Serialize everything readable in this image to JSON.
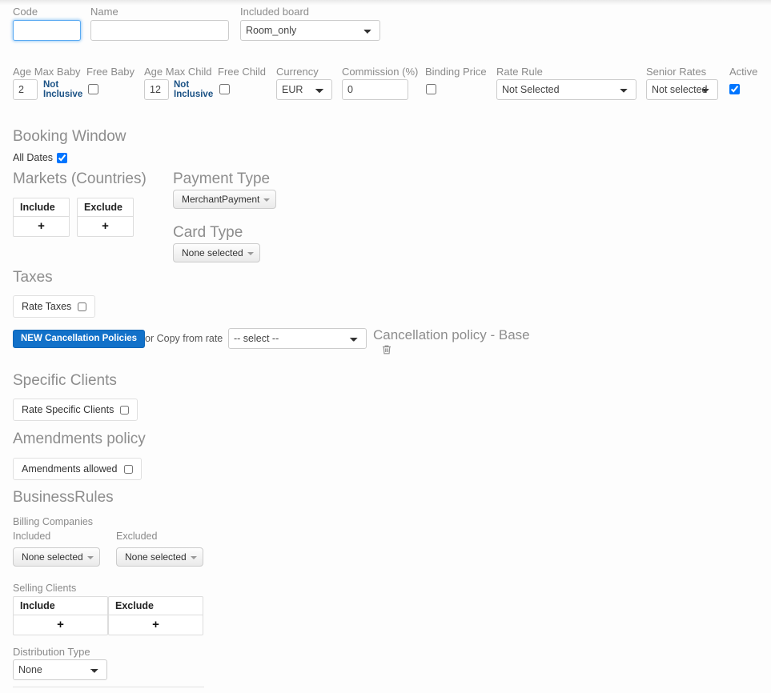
{
  "row1": {
    "code": {
      "label": "Code",
      "value": "",
      "placeholder": ""
    },
    "name": {
      "label": "Name",
      "value": "",
      "placeholder": ""
    },
    "included_board": {
      "label": "Included board",
      "value": "Room_only"
    }
  },
  "row2": {
    "age_max_baby": {
      "label": "Age Max Baby",
      "value": "2",
      "note": "Not Inclusive"
    },
    "free_baby": {
      "label": "Free Baby",
      "checked": false
    },
    "age_max_child": {
      "label": "Age Max Child",
      "value": "12",
      "note": "Not Inclusive"
    },
    "free_child": {
      "label": "Free Child",
      "checked": false
    },
    "currency": {
      "label": "Currency",
      "value": "EUR"
    },
    "commission": {
      "label": "Commission (%)",
      "value": "0"
    },
    "binding_price": {
      "label": "Binding Price",
      "checked": false
    },
    "rate_rule": {
      "label": "Rate Rule",
      "value": "Not Selected"
    },
    "senior_rates": {
      "label": "Senior Rates",
      "value": "Not selected"
    },
    "active": {
      "label": "Active",
      "checked": true
    }
  },
  "booking_window": {
    "title": "Booking Window",
    "all_dates_label": "All Dates",
    "all_dates_checked": true
  },
  "markets": {
    "title": "Markets (Countries)",
    "include_header": "Include",
    "exclude_header": "Exclude",
    "add_symbol": "+"
  },
  "payment_type": {
    "title": "Payment Type",
    "value": "MerchantPayment"
  },
  "card_type": {
    "title": "Card Type",
    "value": "None selected"
  },
  "taxes": {
    "title": "Taxes",
    "rate_taxes_label": "Rate Taxes",
    "rate_taxes_checked": false
  },
  "cancellation": {
    "new_button": "NEW Cancellation Policies",
    "copy_label": "or Copy from rate",
    "copy_value": "-- select --",
    "policy_title": "Cancellation policy - Base",
    "delete_icon": "trash-icon"
  },
  "specific_clients": {
    "title": "Specific Clients",
    "checkbox_label": "Rate Specific Clients",
    "checked": false
  },
  "amendments": {
    "title": "Amendments policy",
    "checkbox_label": "Amendments allowed",
    "checked": false
  },
  "business_rules": {
    "title": "BusinessRules",
    "billing_companies_label": "Billing Companies",
    "included_label": "Included",
    "excluded_label": "Excluded",
    "included_value": "None selected",
    "excluded_value": "None selected"
  },
  "selling_clients": {
    "label": "Selling Clients",
    "include_header": "Include",
    "exclude_header": "Exclude",
    "add_symbol": "+"
  },
  "distribution_type": {
    "label": "Distribution Type",
    "value": "None"
  },
  "colors": {
    "accent": "#1271c9",
    "note": "#1b5285",
    "label": "#8a8a8a",
    "heading": "#8d8d8d"
  }
}
